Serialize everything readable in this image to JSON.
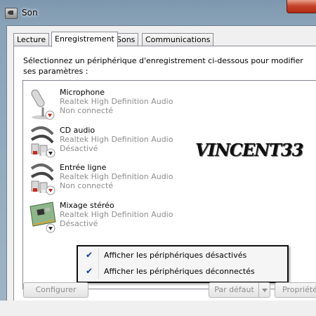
{
  "window": {
    "title": "Son"
  },
  "tabs": [
    {
      "label": "Lecture",
      "active": false
    },
    {
      "label": "Enregistrement",
      "active": true
    },
    {
      "label": "Sons",
      "active": false
    },
    {
      "label": "Communications",
      "active": false
    }
  ],
  "intro": "Sélectionnez un périphérique d'enregistrement ci-dessous pour modifier ses paramètres :",
  "devices": [
    {
      "name": "Microphone",
      "driver": "Realtek High Definition Audio",
      "status": "Non connecté",
      "icon": "microphone-icon"
    },
    {
      "name": "CD audio",
      "driver": "Realtek High Definition Audio",
      "status": "Désactivé",
      "icon": "rca-cable-icon"
    },
    {
      "name": "Entrée ligne",
      "driver": "Realtek High Definition Audio",
      "status": "Non connecté",
      "icon": "rca-cable-icon"
    },
    {
      "name": "Mixage stéréo",
      "driver": "Realtek High Definition Audio",
      "status": "Désactivé",
      "icon": "sound-card-icon"
    }
  ],
  "watermark": "VINCENT33",
  "context_menu": [
    {
      "label": "Afficher les périphériques désactivés",
      "checked": true
    },
    {
      "label": "Afficher les périphériques déconnectés",
      "checked": true
    }
  ],
  "buttons": {
    "configure": "Configurer",
    "default": "Par défaut",
    "properties": "Propriété"
  }
}
